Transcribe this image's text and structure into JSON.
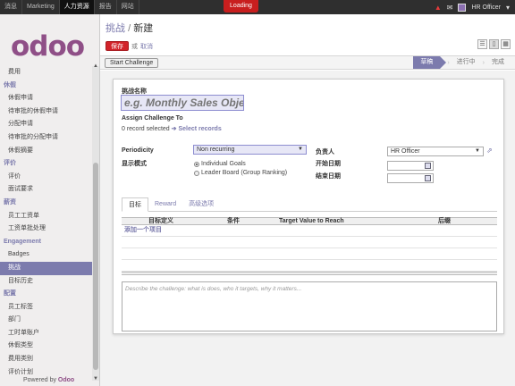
{
  "topbar": {
    "menu": [
      {
        "label": "消息",
        "active": false
      },
      {
        "label": "Marketing",
        "active": false
      },
      {
        "label": "人力资源",
        "active": true
      },
      {
        "label": "报告",
        "active": false
      },
      {
        "label": "网站",
        "active": false
      }
    ],
    "loading": "Loading",
    "user": "HR Officer"
  },
  "sidebar": {
    "logo": "odoo",
    "items": [
      {
        "kind": "item",
        "label": "费用"
      },
      {
        "kind": "head",
        "label": "休假"
      },
      {
        "kind": "item",
        "label": "休假申请"
      },
      {
        "kind": "item",
        "label": "待审批的休假申请"
      },
      {
        "kind": "item",
        "label": "分配申请"
      },
      {
        "kind": "item",
        "label": "待审批的分配申请"
      },
      {
        "kind": "item",
        "label": "休假摘要"
      },
      {
        "kind": "head",
        "label": "评价"
      },
      {
        "kind": "item",
        "label": "评价"
      },
      {
        "kind": "item",
        "label": "面试要求"
      },
      {
        "kind": "head",
        "label": "薪资"
      },
      {
        "kind": "item",
        "label": "员工工资单"
      },
      {
        "kind": "item",
        "label": "工资单批处理"
      },
      {
        "kind": "head",
        "label": "Engagement"
      },
      {
        "kind": "item",
        "label": "Badges"
      },
      {
        "kind": "item",
        "label": "挑战",
        "selected": true
      },
      {
        "kind": "item",
        "label": "目标历史"
      },
      {
        "kind": "head",
        "label": "配置"
      },
      {
        "kind": "item",
        "label": "员工标签"
      },
      {
        "kind": "item",
        "label": "部门"
      },
      {
        "kind": "item",
        "label": "工时单账户"
      },
      {
        "kind": "item",
        "label": "休假类型"
      },
      {
        "kind": "item",
        "label": "费用类别"
      },
      {
        "kind": "item",
        "label": "评价计划"
      }
    ],
    "powered_prefix": "Powered by",
    "powered_brand": "Odoo"
  },
  "header": {
    "breadcrumb_parent": "挑战",
    "breadcrumb_sep": "/",
    "breadcrumb_current": "新建",
    "save_label": "保存",
    "or_label": "或",
    "discard_label": "取消"
  },
  "statusbar": {
    "start_button": "Start Challenge",
    "stages": [
      {
        "label": "草稿",
        "current": true
      },
      {
        "label": "进行中",
        "current": false
      },
      {
        "label": "完成",
        "current": false
      }
    ]
  },
  "form": {
    "name_label": "挑战名称",
    "name_placeholder": "e.g. Monthly Sales Objectives",
    "assign_label": "Assign Challenge To",
    "assign_value": "0 record selected",
    "select_records": "Select records",
    "periodicity_label": "Periodicity",
    "periodicity_value": "Non recurring",
    "display_mode_label": "显示模式",
    "display_options": [
      {
        "label": "Individual Goals",
        "checked": true
      },
      {
        "label": "Leader Board (Group Ranking)",
        "checked": false
      }
    ],
    "manager_label": "负责人",
    "manager_value": "HR Officer",
    "start_date_label": "开始日期",
    "end_date_label": "结束日期"
  },
  "tabs": [
    {
      "label": "目标",
      "active": true
    },
    {
      "label": "Reward",
      "active": false
    },
    {
      "label": "高级选项",
      "active": false
    }
  ],
  "goals_table": {
    "columns": [
      "目标定义",
      "条件",
      "Target Value to Reach",
      "后缀"
    ],
    "add_item": "添加一个项目"
  },
  "description_placeholder": "Describe the challenge: what is does, who it targets, why it matters..."
}
